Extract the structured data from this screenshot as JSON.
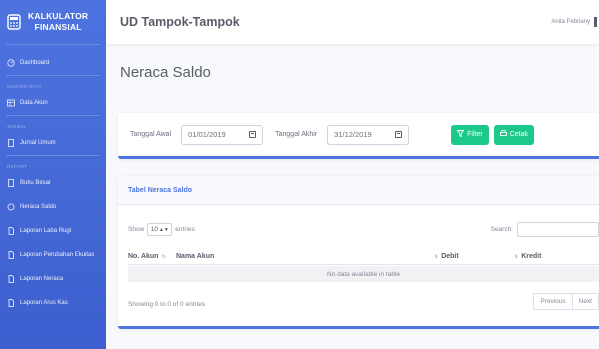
{
  "brand": {
    "line1": "KALKULATOR",
    "line2": "FINANSIAL"
  },
  "sidebar": {
    "dashboard": "Dashboard",
    "master_data_heading": "MASTER DATA",
    "data_akun": "Data Akun",
    "jurnal_heading": "JURNAL",
    "jurnal_umum": "Jurnal Umum",
    "report_heading": "REPORT",
    "report_items": [
      "Buku Besar",
      "Neraca Saldo",
      "Laporan Laba Rugi",
      "Laporan Perubahan Ekuitas",
      "Laporan Neraca",
      "Laporan Arus Kas"
    ]
  },
  "topbar": {
    "company": "UD Tampok-Tampok",
    "user": "Anita Febriany"
  },
  "page": {
    "title": "Neraca Saldo"
  },
  "filter": {
    "start_label": "Tanggal Awal",
    "start_value": "01/01/2019",
    "end_label": "Tanggal Akhir",
    "end_value": "31/12/2019",
    "filter_button": "Filter",
    "print_button": "Cetak"
  },
  "table": {
    "title": "Tabel Neraca Saldo",
    "show_label": "Show",
    "page_size": "10",
    "entries_label": "entries",
    "search_label": "Search:",
    "columns": [
      "No. Akun",
      "Nama Akun",
      "Debit",
      "Kredit"
    ],
    "empty_text": "No data available in table",
    "info": "Showing 0 to 0 of 0 entries",
    "prev": "Previous",
    "next": "Next"
  },
  "colors": {
    "primary": "#4e73df",
    "success": "#1cc88a"
  }
}
